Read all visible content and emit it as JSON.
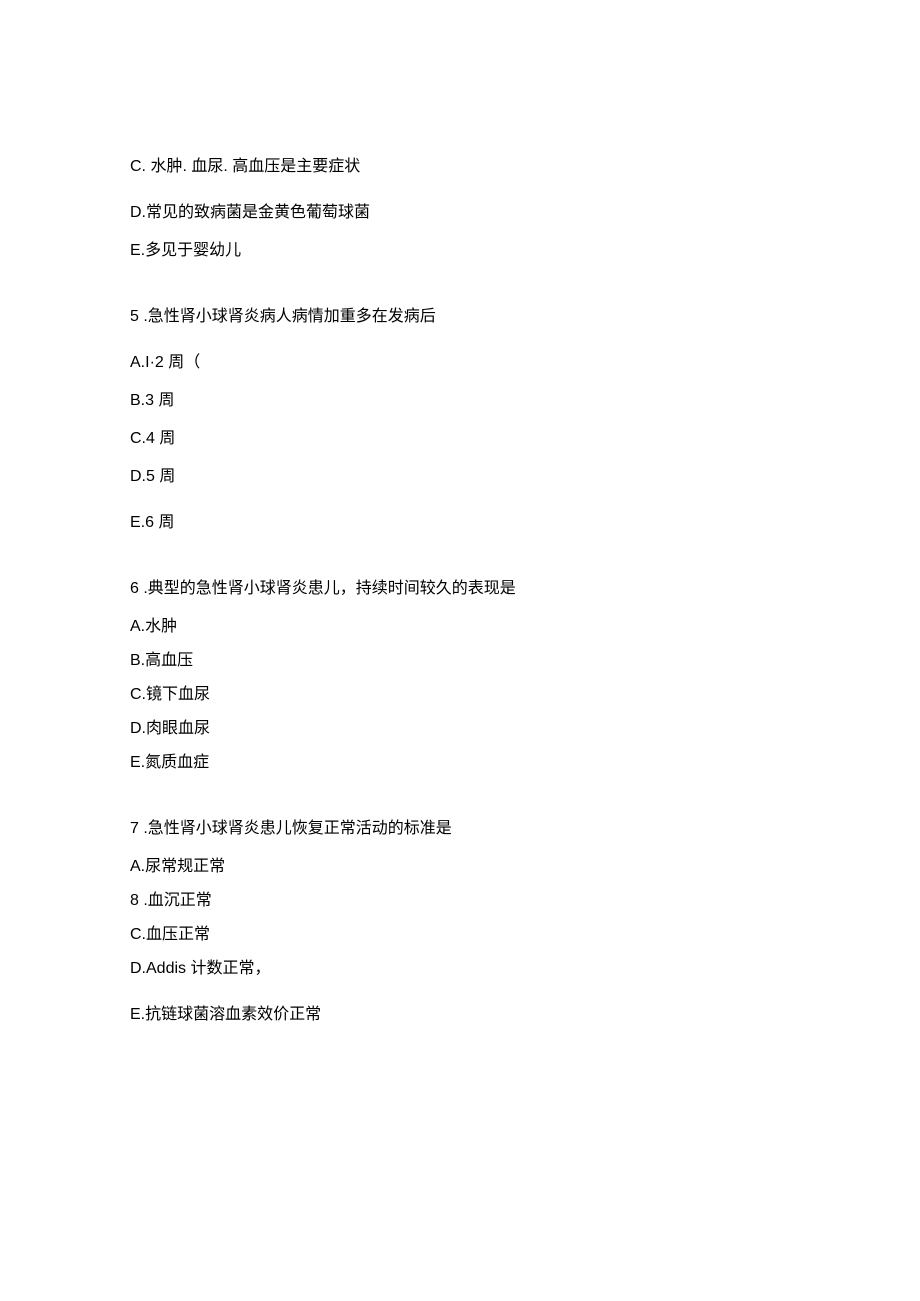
{
  "partial_question_4": {
    "option_c": "C. 水肿. 血尿. 高血压是主要症状",
    "option_d": "D.常见的致病菌是金黄色葡萄球菌",
    "option_e": "E.多见于婴幼儿"
  },
  "question_5": {
    "stem": "5   .急性肾小球肾炎病人病情加重多在发病后",
    "option_a": "A.I·2 周（",
    "option_b": "B.3 周",
    "option_c": "C.4 周",
    "option_d": "D.5 周",
    "option_e": "E.6 周"
  },
  "question_6": {
    "stem": "6   .典型的急性肾小球肾炎患儿，持续时间较久的表现是",
    "option_a": "A.水肿",
    "option_b": "B.高血压",
    "option_c": "C.镜下血尿",
    "option_d": "D.肉眼血尿",
    "option_e": "E.氮质血症"
  },
  "question_7": {
    "stem": "7   .急性肾小球肾炎患儿恢复正常活动的标准是",
    "option_a": "A.尿常规正常",
    "option_b": "8   .血沉正常",
    "option_c": "C.血压正常",
    "option_d": "D.Addis 计数正常，",
    "option_e": "E.抗链球菌溶血素效价正常"
  }
}
